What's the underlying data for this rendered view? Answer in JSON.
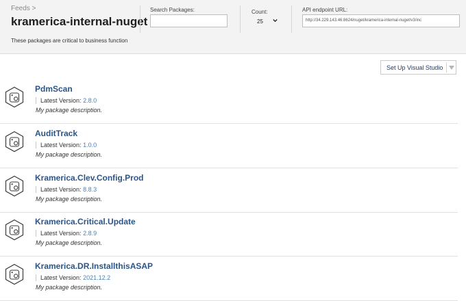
{
  "header": {
    "breadcrumb": "Feeds >",
    "feed_title": "kramerica-internal-nuget",
    "feed_description": "These packages are critical to business function",
    "search": {
      "label": "Search Packages:",
      "value": "",
      "placeholder": ""
    },
    "count": {
      "label": "Count:",
      "value": "25"
    },
    "api": {
      "label": "API endpoint URL:",
      "value": "http://34.229.143.46:8624/nuget/kramerica-internal-nuget/v3/inc"
    }
  },
  "toolbar": {
    "setup_label": "Set Up Visual Studio"
  },
  "version_label": "Latest Version:",
  "packages": [
    {
      "name": "PdmScan",
      "version": "2.8.0",
      "description": "My package description."
    },
    {
      "name": "AuditTrack",
      "version": "1.0.0",
      "description": "My package description."
    },
    {
      "name": "Kramerica.Clev.Config.Prod",
      "version": "8.8.3",
      "description": "My package description."
    },
    {
      "name": "Kramerica.Critical.Update",
      "version": "2.8.9",
      "description": "My package description."
    },
    {
      "name": "Kramerica.DR.InstallthisASAP",
      "version": "2021.12.2",
      "description": "My package description."
    }
  ],
  "colors": {
    "link": "#2b5486",
    "version": "#4a7fb6",
    "header_bg": "#f3f3f3"
  },
  "icons": {
    "package": "nuget-package-icon",
    "dropdown": "chevron-down-icon",
    "caret": "caret-down-icon"
  }
}
